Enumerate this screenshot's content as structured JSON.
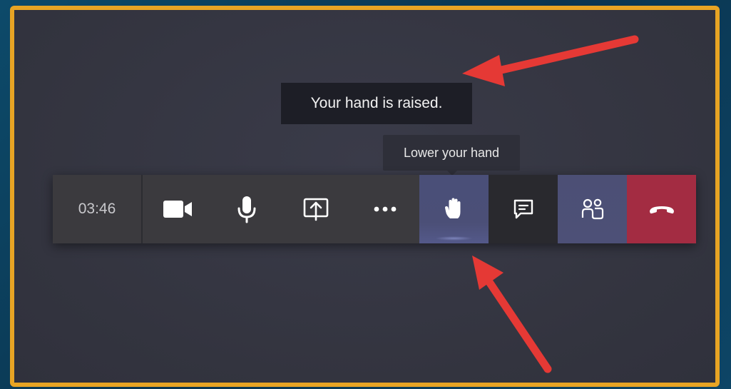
{
  "tooltips": {
    "status": "Your hand is raised.",
    "hint": "Lower your hand"
  },
  "toolbar": {
    "timer": "03:46",
    "buttons": [
      {
        "name": "camera-button",
        "icon": "video-camera-icon",
        "state": "on"
      },
      {
        "name": "mic-button",
        "icon": "microphone-icon",
        "state": "on"
      },
      {
        "name": "share-button",
        "icon": "share-screen-icon"
      },
      {
        "name": "more-actions-button",
        "icon": "more-options-icon"
      },
      {
        "name": "raise-hand-button",
        "icon": "hand-icon",
        "state": "active"
      },
      {
        "name": "chat-button",
        "icon": "chat-icon"
      },
      {
        "name": "participants-button",
        "icon": "people-icon",
        "state": "active"
      },
      {
        "name": "hang-up-button",
        "icon": "phone-hang-up-icon"
      }
    ]
  },
  "colors": {
    "frame_border": "#e7a424",
    "meeting_bg": "#363744",
    "active_button": "#4b4f77",
    "hang_up": "#a32c42",
    "annotation_arrow": "#e53935"
  },
  "annotations": [
    {
      "name": "arrow-to-status-tooltip",
      "target": "status"
    },
    {
      "name": "arrow-to-raise-hand-button",
      "target": "raise-hand-button"
    }
  ]
}
